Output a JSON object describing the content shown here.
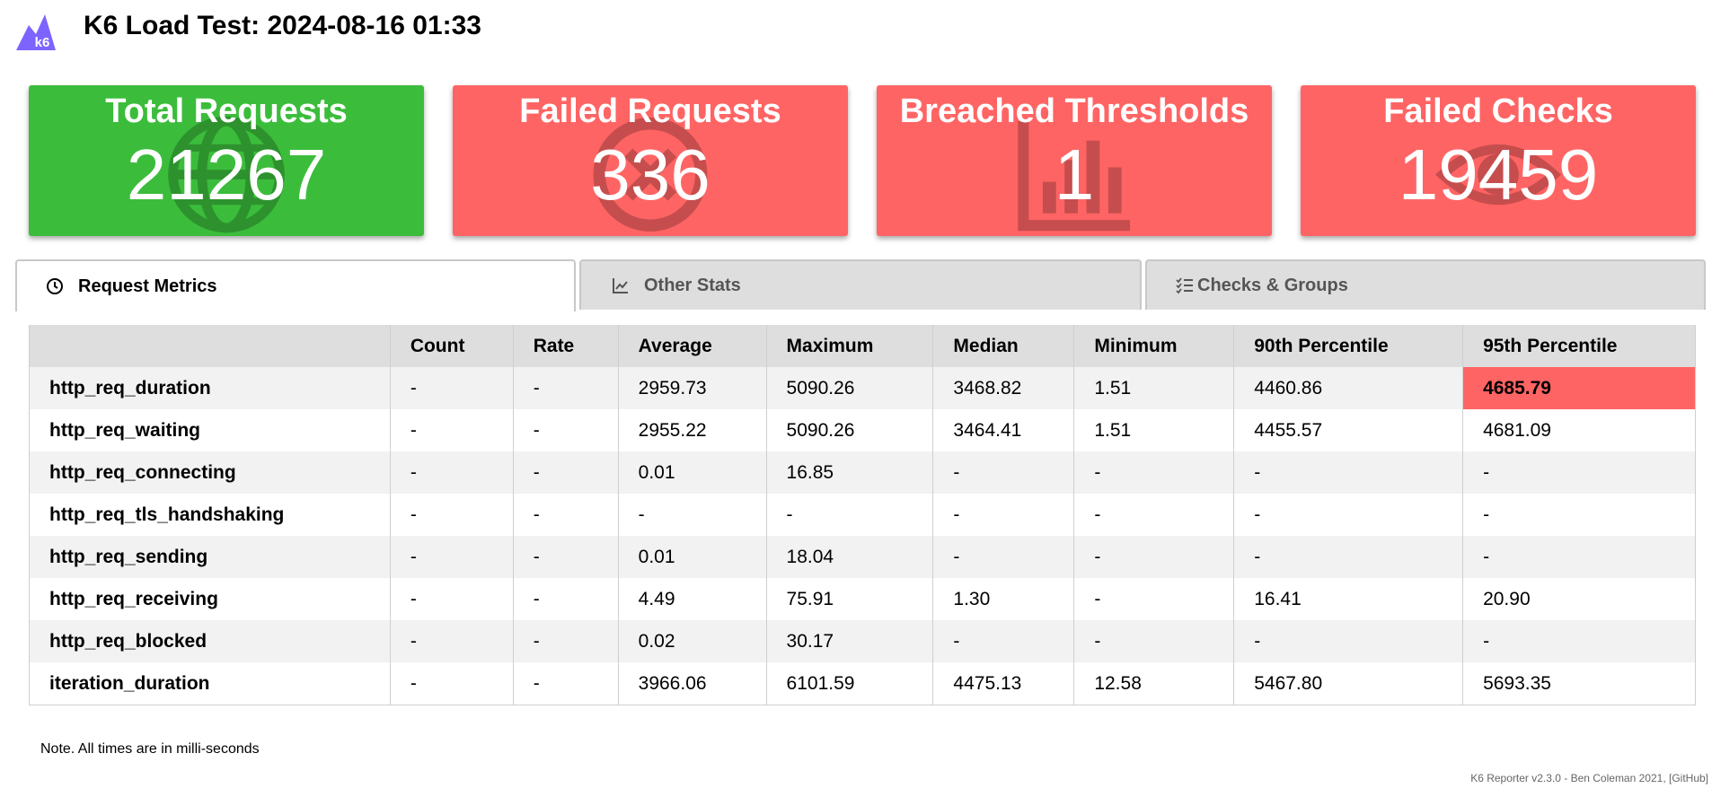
{
  "header": {
    "logo_text": "k6",
    "title": "K6 Load Test: 2024-08-16 01:33"
  },
  "cards": [
    {
      "label": "Total Requests",
      "value": "21267",
      "color": "#3bbd3b",
      "icon": "globe-icon"
    },
    {
      "label": "Failed Requests",
      "value": "336",
      "color": "#ff6464",
      "icon": "x-circle-icon"
    },
    {
      "label": "Breached Thresholds",
      "value": "1",
      "color": "#ff6464",
      "icon": "bar-chart-icon"
    },
    {
      "label": "Failed Checks",
      "value": "19459",
      "color": "#ff6464",
      "icon": "eye-icon"
    }
  ],
  "tabs": [
    {
      "label": "Request Metrics",
      "icon": "clock-icon",
      "active": true
    },
    {
      "label": "Other Stats",
      "icon": "line-chart-icon",
      "active": false
    },
    {
      "label": "Checks & Groups",
      "icon": "checklist-icon",
      "active": false
    }
  ],
  "table": {
    "headers": [
      "",
      "Count",
      "Rate",
      "Average",
      "Maximum",
      "Median",
      "Minimum",
      "90th Percentile",
      "95th Percentile"
    ],
    "rows": [
      [
        "http_req_duration",
        "-",
        "-",
        "2959.73",
        "5090.26",
        "3468.82",
        "1.51",
        "4460.86",
        "4685.79"
      ],
      [
        "http_req_waiting",
        "-",
        "-",
        "2955.22",
        "5090.26",
        "3464.41",
        "1.51",
        "4455.57",
        "4681.09"
      ],
      [
        "http_req_connecting",
        "-",
        "-",
        "0.01",
        "16.85",
        "-",
        "-",
        "-",
        "-"
      ],
      [
        "http_req_tls_handshaking",
        "-",
        "-",
        "-",
        "-",
        "-",
        "-",
        "-",
        "-"
      ],
      [
        "http_req_sending",
        "-",
        "-",
        "0.01",
        "18.04",
        "-",
        "-",
        "-",
        "-"
      ],
      [
        "http_req_receiving",
        "-",
        "-",
        "4.49",
        "75.91",
        "1.30",
        "-",
        "16.41",
        "20.90"
      ],
      [
        "http_req_blocked",
        "-",
        "-",
        "0.02",
        "30.17",
        "-",
        "-",
        "-",
        "-"
      ],
      [
        "iteration_duration",
        "-",
        "-",
        "3966.06",
        "6101.59",
        "4475.13",
        "12.58",
        "5467.80",
        "5693.35"
      ]
    ],
    "breach_color": "#ff6464"
  },
  "note": "Note. All times are in milli-seconds",
  "footer": "K6 Reporter v2.3.0 - Ben Coleman 2021, [GitHub]"
}
